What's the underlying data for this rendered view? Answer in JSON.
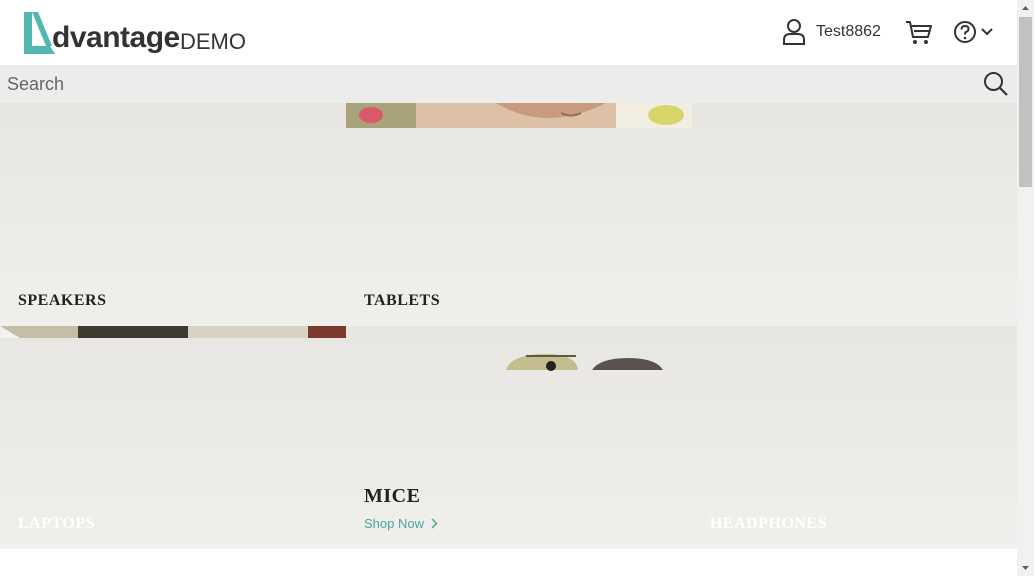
{
  "header": {
    "logo_text": "dvantage",
    "logo_demo": "DEMO",
    "username": "Test8862",
    "brand_color": "#54b6b0"
  },
  "search": {
    "placeholder": "Search",
    "value": ""
  },
  "categories": [
    {
      "label": "SPEAKERS"
    },
    {
      "label": "TABLETS"
    },
    {
      "label": "LAPTOPS"
    },
    {
      "label": "MICE",
      "link": "Shop Now"
    },
    {
      "label": "HEADPHONES"
    }
  ],
  "colors": {
    "search_bar": "#ececeb",
    "tile_background": "#e9e8e4",
    "link": "#4aa79c"
  }
}
